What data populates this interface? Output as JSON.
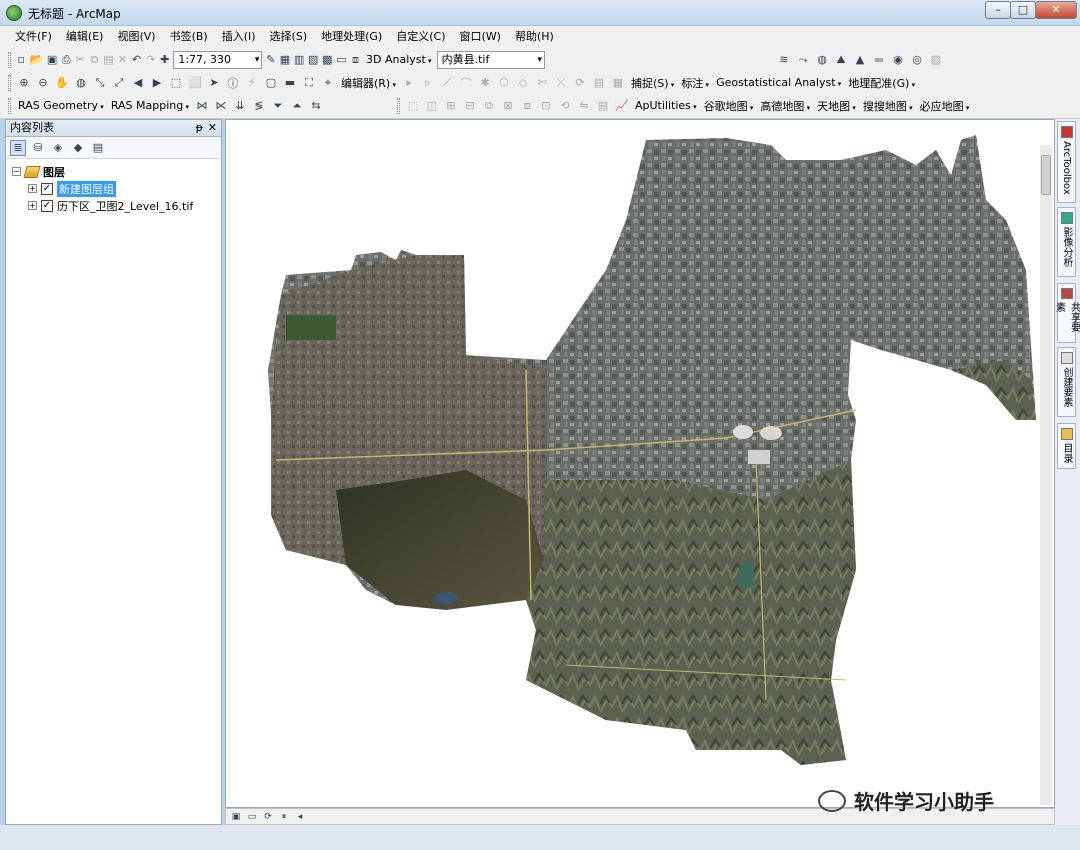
{
  "window": {
    "title": "无标题 - ArcMap",
    "min": "–",
    "max": "□",
    "close": "✕"
  },
  "menu": [
    "文件(F)",
    "编辑(E)",
    "视图(V)",
    "书签(B)",
    "插入(I)",
    "选择(S)",
    "地理处理(G)",
    "自定义(C)",
    "窗口(W)",
    "帮助(H)"
  ],
  "toolbar": {
    "scale": "1:77, 330",
    "analyst3d": "3D Analyst",
    "layer_select": "内黄县.tif",
    "editor": "编辑器(R)",
    "snapping": "捕捉(S)",
    "label": "标注",
    "geostat": "Geostatistical Analyst",
    "georef": "地理配准(G)",
    "ras_geometry": "RAS Geometry",
    "ras_mapping": "RAS Mapping",
    "aputilities": "ApUtilities",
    "maps": [
      "谷歌地图",
      "高德地图",
      "天地图",
      "搜搜地图",
      "必应地图"
    ]
  },
  "toc": {
    "title": "内容列表",
    "pin": "ᵽ",
    "close": "✕",
    "root": "图层",
    "items": [
      {
        "label": "新建图层组",
        "checked": "✓",
        "expander": "+"
      },
      {
        "label": "历下区_卫图2_Level_16.tif",
        "checked": "✓",
        "expander": "+"
      }
    ]
  },
  "dock": {
    "tabs": [
      "ArcToolbox",
      "影像分析",
      "共享要素",
      "创建要素",
      "目录"
    ]
  },
  "watermark": "软件学习小助手"
}
